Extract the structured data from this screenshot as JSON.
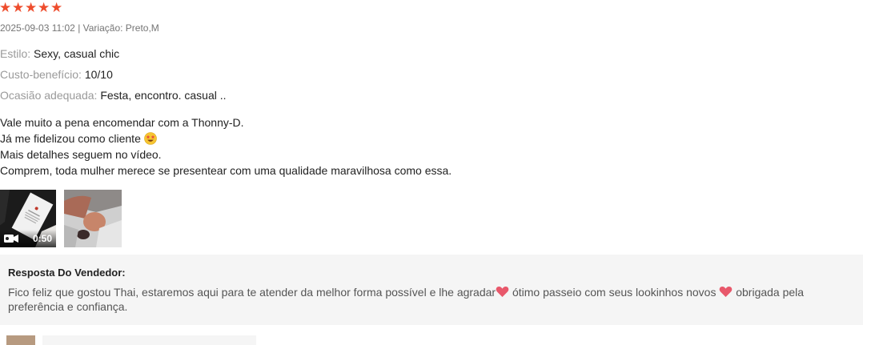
{
  "review": {
    "rating": 5,
    "rating_max": 5,
    "star_color": "#ee4d2d",
    "meta": "2025-09-03 11:02 | Variação: Preto,M",
    "fields": [
      {
        "label": "Estilo:",
        "value": "Sexy, casual chic"
      },
      {
        "label": "Custo-benefício:",
        "value": "10/10"
      },
      {
        "label": "Ocasião adequada:",
        "value": "Festa, encontro. casual .."
      }
    ],
    "body_lines": [
      "Vale muito a pena encomendar com a Thonny-D.",
      "Já me fidelizou como cliente",
      "Mais detalhes seguem no vídeo.",
      "Comprem, toda mulher merece se presentear com uma qualidade maravilhosa como essa."
    ],
    "body_emoji_icon": "star-struck-emoji-icon",
    "media": [
      {
        "type": "video",
        "duration": "0:50",
        "icon": "video-camera-icon"
      },
      {
        "type": "image"
      }
    ]
  },
  "seller_reply": {
    "title": "Resposta Do Vendedor:",
    "segments": [
      "Fico feliz que gostou Thai, estaremos aqui para te atender da melhor forma possível e lhe agradar",
      " ótimo passeio com seus lookinhos novos ",
      " obrigada pela preferência e confiança."
    ],
    "heart_icon": "heart-icon",
    "heart_color": "#e8586b"
  }
}
